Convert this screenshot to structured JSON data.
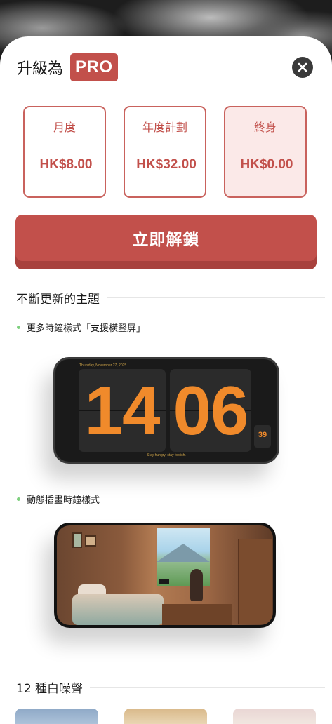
{
  "header": {
    "title": "升級為",
    "badge": "PRO"
  },
  "plans": [
    {
      "name": "月度",
      "price": "HK$8.00",
      "selected": false
    },
    {
      "name": "年度計劃",
      "price": "HK$32.00",
      "selected": false
    },
    {
      "name": "終身",
      "price": "HK$0.00",
      "selected": true
    }
  ],
  "unlock_label": "立即解鎖",
  "section1": {
    "title": "不斷更新的主題",
    "bullet1": "更多時鐘樣式「支援橫豎屏」",
    "bullet2": "動態插畫時鐘樣式"
  },
  "clock_preview": {
    "date": "Thursday, November 27, 2025",
    "hours": "14",
    "minutes": "06",
    "seconds": "39",
    "quote": "Stay hungry, stay foolish."
  },
  "section2": {
    "title": "12 種白噪聲"
  },
  "colors": {
    "accent": "#c2504b",
    "selected_bg": "#fbe9e8",
    "bullet": "#7fd07f",
    "digit": "#f08a2b"
  },
  "icons": {
    "close": "close-icon"
  }
}
